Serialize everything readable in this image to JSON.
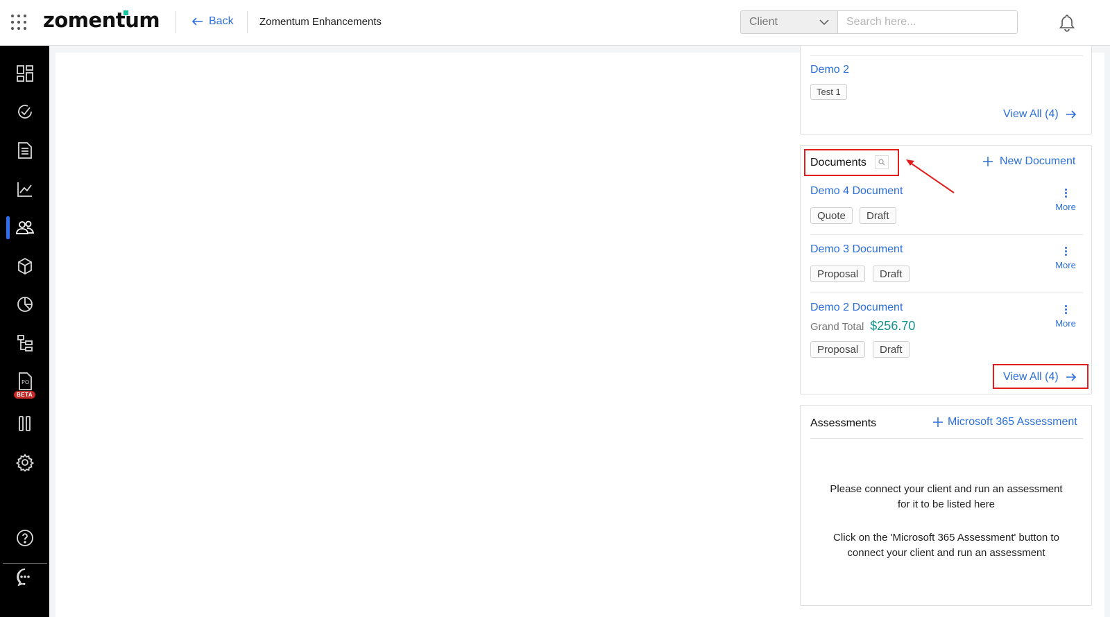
{
  "header": {
    "logo": "zomentum",
    "back_label": "Back",
    "breadcrumb": "Zomentum Enhancements",
    "client_select": "Client",
    "search_placeholder": "Search here..."
  },
  "sidebar": {
    "items": [
      {
        "icon": "dashboard-icon"
      },
      {
        "icon": "activity-icon"
      },
      {
        "icon": "documents-icon"
      },
      {
        "icon": "analytics-icon"
      },
      {
        "icon": "clients-icon",
        "active": true
      },
      {
        "icon": "products-icon"
      },
      {
        "icon": "reports-icon"
      },
      {
        "icon": "workflow-icon"
      },
      {
        "icon": "purchase-order-icon",
        "badge": "BETA"
      },
      {
        "icon": "pipeline-icon"
      },
      {
        "icon": "settings-icon"
      }
    ],
    "bottom": [
      {
        "icon": "help-icon"
      },
      {
        "icon": "chat-icon"
      }
    ]
  },
  "prev_card": {
    "item_title": "Demo 2",
    "item_tag": "Test 1",
    "view_all": "View All (4)"
  },
  "documents": {
    "title": "Documents",
    "new_label": "New Document",
    "items": [
      {
        "title": "Demo 4 Document",
        "tags": [
          "Quote",
          "Draft"
        ],
        "more": "More"
      },
      {
        "title": "Demo 3 Document",
        "tags": [
          "Proposal",
          "Draft"
        ],
        "more": "More"
      },
      {
        "title": "Demo 2 Document",
        "grand_total_label": "Grand Total",
        "grand_total": "$256.70",
        "tags": [
          "Proposal",
          "Draft"
        ],
        "more": "More"
      }
    ],
    "view_all": "View All (4)"
  },
  "assessments": {
    "title": "Assessments",
    "new_label": "Microsoft 365 Assessment",
    "message1": "Please connect your client and run an assessment for it to be listed here",
    "message2": "Click on the 'Microsoft 365 Assessment' button to connect your client and run an assessment"
  },
  "colors": {
    "accent": "#2a6fdb",
    "total": "#15918f",
    "annotation": "#e11d1d",
    "sidebar": "#000000",
    "active_indicator": "#2f6ef0"
  }
}
